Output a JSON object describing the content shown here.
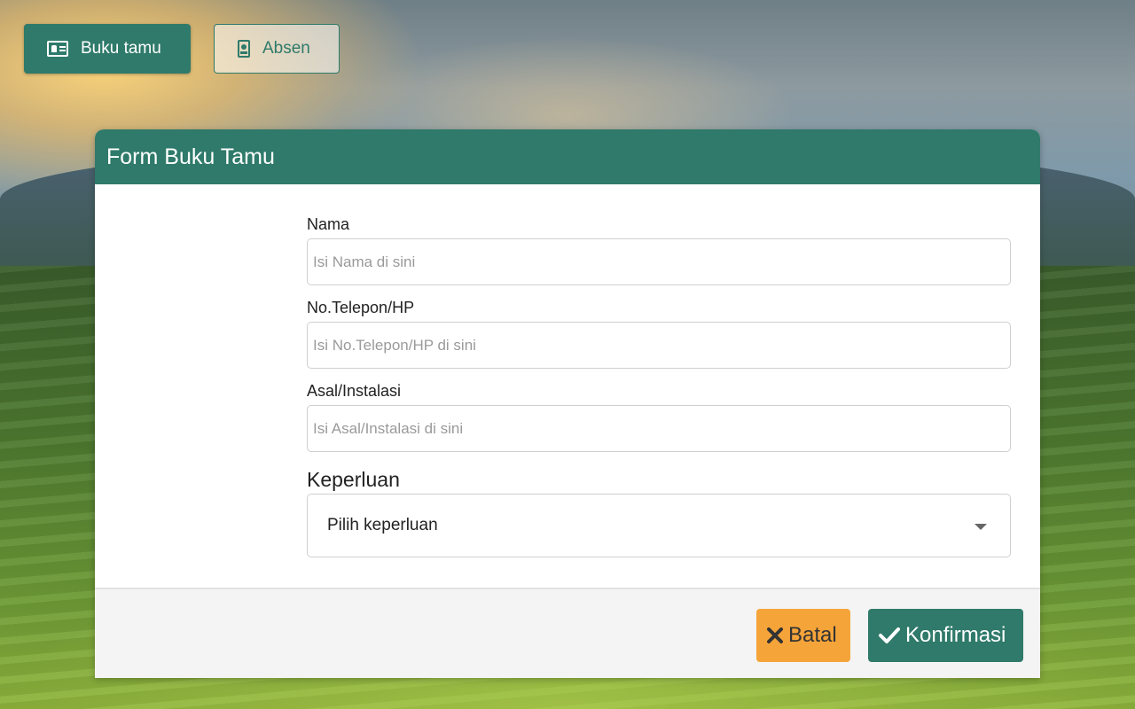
{
  "top_nav": {
    "guestbook_label": "Buku tamu",
    "attendance_label": "Absen"
  },
  "dialog": {
    "title": "Form Buku Tamu",
    "fields": [
      {
        "label": "Nama",
        "placeholder": "Isi Nama di sini",
        "value": ""
      },
      {
        "label": "No.Telepon/HP",
        "placeholder": "Isi No.Telepon/HP di sini",
        "value": ""
      },
      {
        "label": "Asal/Instalasi",
        "placeholder": "Isi Asal/Instalasi di sini",
        "value": ""
      }
    ],
    "purpose": {
      "label": "Keperluan",
      "selected": "Pilih keperluan"
    },
    "cancel_label": "Batal",
    "confirm_label": "Konfirmasi"
  },
  "colors": {
    "primary": "#2f7a6a",
    "cancel": "#f5a43a"
  },
  "icons": {
    "guestbook": "id-card-icon",
    "attendance": "badge-icon",
    "cancel": "close-icon",
    "confirm": "check-icon",
    "dropdown": "caret-down-icon"
  }
}
